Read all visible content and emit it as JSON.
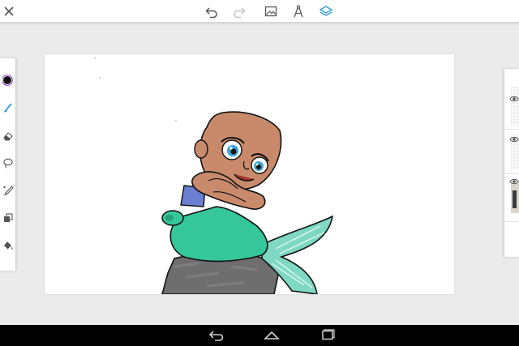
{
  "app": {
    "accent_color": "#2f9fd8",
    "icon_color": "#555555"
  },
  "top_toolbar": {
    "left": [
      "close-icon"
    ],
    "center": [
      "undo-icon",
      "redo-icon",
      "image-icon",
      "compass-icon",
      "layers-icon"
    ],
    "active": "layers-icon",
    "disabled": [
      "redo-icon"
    ]
  },
  "left_toolbar": {
    "tools": [
      "color-picker",
      "brush",
      "eraser",
      "lasso",
      "pen",
      "shape",
      "fill"
    ],
    "active_tool": "brush",
    "current_color": "#111111"
  },
  "layers_panel": {
    "layers": [
      {
        "visible": true,
        "thumbnail": "empty"
      },
      {
        "visible": true,
        "thumbnail": "empty"
      },
      {
        "visible": true,
        "thumbnail": "photo"
      }
    ]
  },
  "navbar": {
    "buttons": [
      "back-icon",
      "home-icon",
      "recents-icon"
    ]
  }
}
